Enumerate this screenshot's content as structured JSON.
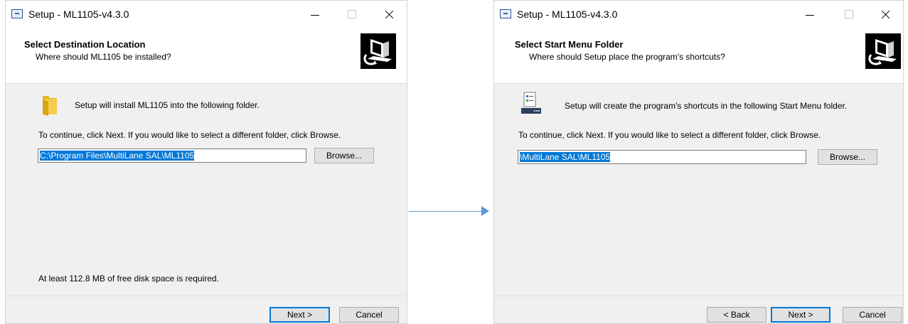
{
  "window1": {
    "title": "Setup - ML1105-v4.3.0",
    "header_title": "Select Destination Location",
    "header_subtitle": "Where should ML1105 be installed?",
    "install_text": "Setup will install ML1105 into the following folder.",
    "continue_text": "To continue, click Next. If you would like to select a different folder, click Browse.",
    "path_value": "C:\\Program Files\\MultiLane SAL\\ML1105",
    "browse_label": "Browse...",
    "disk_space_text": "At least 112.8 MB of free disk space is required.",
    "next_label": "Next >",
    "cancel_label": "Cancel"
  },
  "window2": {
    "title": "Setup - ML1105-v4.3.0",
    "header_title": "Select Start Menu Folder",
    "header_subtitle": "Where should Setup place the program's shortcuts?",
    "shortcut_text": "Setup will create the program's shortcuts in the following Start Menu folder.",
    "continue_text": "To continue, click Next. If you would like to select a different folder, click Browse.",
    "folder_value": "\\MultiLane SAL\\ML1105",
    "browse_label": "Browse...",
    "back_label": "< Back",
    "next_label": "Next >",
    "cancel_label": "Cancel"
  },
  "colors": {
    "accent": "#0078d7",
    "arrow": "#5b9bd5",
    "dialog_bg": "#f0f0f0"
  },
  "icons": {
    "app": "setup-app-icon",
    "folder": "folder-icon",
    "start_menu": "start-menu-folder-icon",
    "wizard": "computer-wizard-icon",
    "arrow": "right-arrow-icon"
  }
}
